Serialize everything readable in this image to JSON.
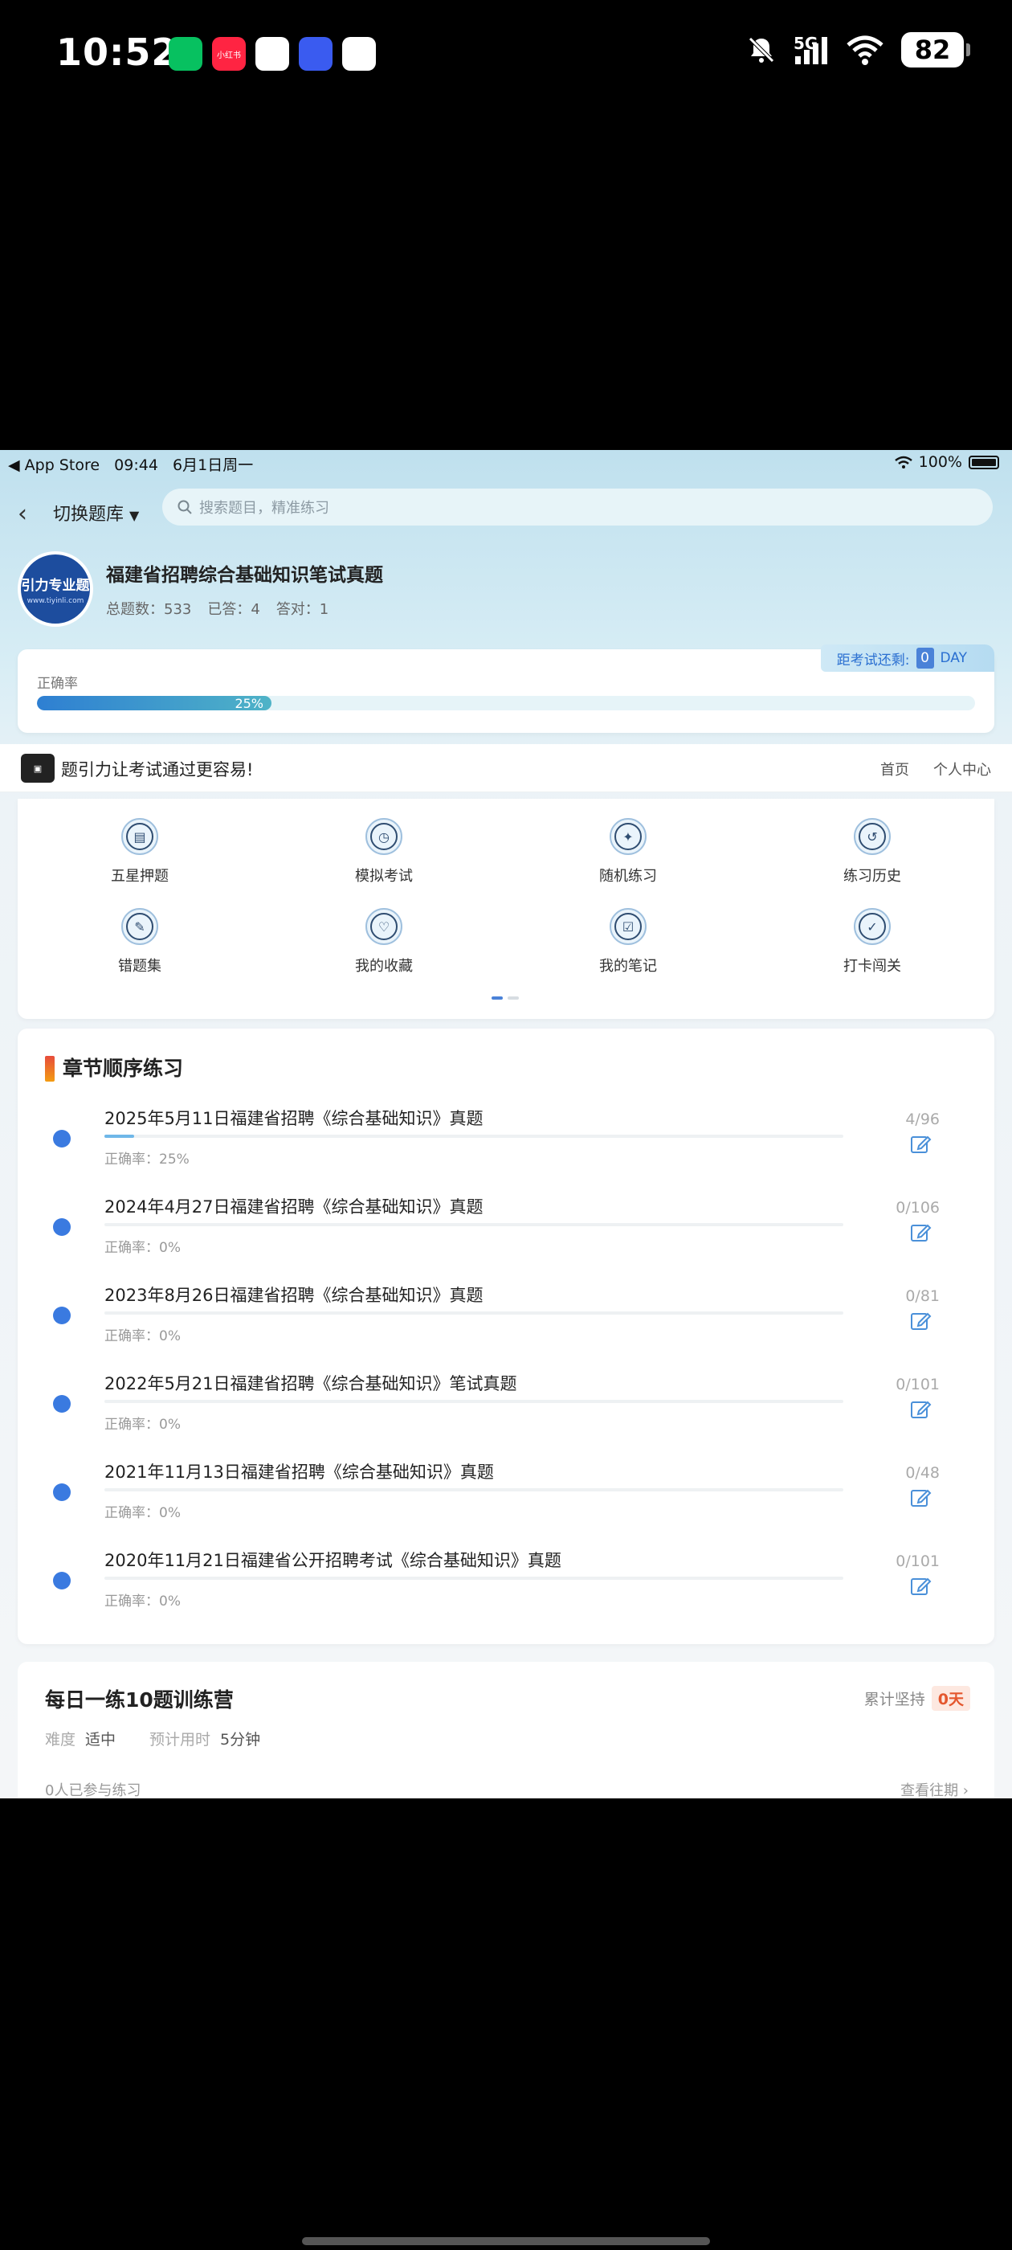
{
  "os_status": {
    "time": "10:52",
    "network": "5G",
    "battery": "82",
    "apps": [
      {
        "name": "wechat-app-icon",
        "color": "#07c160",
        "label": ""
      },
      {
        "name": "xiaohongshu-app-icon",
        "color": "#ff2442",
        "label": "小红书"
      },
      {
        "name": "app-icon-3",
        "color": "#ffffff",
        "label": ""
      },
      {
        "name": "app-icon-4",
        "color": "#3a5bf0",
        "label": ""
      },
      {
        "name": "app-icon-5",
        "color": "#ffffff",
        "label": ""
      }
    ]
  },
  "ios_bar": {
    "back_app": "◀ App Store",
    "time": "09:44",
    "date": "6月1日周一",
    "battery": "100%"
  },
  "nav": {
    "switch_label": "切换题库",
    "search_placeholder": "搜索题目，精准练习"
  },
  "bank": {
    "logo_big": "引力专业题",
    "logo_small": "www.tiyinli.com",
    "title": "福建省招聘综合基础知识笔试真题",
    "total": "总题数：533",
    "answered": "已答：4",
    "correct": "答对：1"
  },
  "accuracy": {
    "label": "正确率",
    "percent": "25%",
    "fraction": 0.25,
    "countdown_label": "距考试还剩:",
    "countdown_value": "0",
    "countdown_unit": "DAY"
  },
  "slogan": {
    "text": "题引力让考试通过更容易!",
    "link_home": "首页",
    "link_user": "个人中心"
  },
  "menu": [
    {
      "label": "五星押题",
      "icon": "star-exam-icon",
      "glyph": "▤"
    },
    {
      "label": "模拟考试",
      "icon": "mock-exam-icon",
      "glyph": "◷"
    },
    {
      "label": "随机练习",
      "icon": "random-practice-icon",
      "glyph": "✦"
    },
    {
      "label": "练习历史",
      "icon": "history-icon",
      "glyph": "↺"
    },
    {
      "label": "错题集",
      "icon": "wrong-questions-icon",
      "glyph": "✎"
    },
    {
      "label": "我的收藏",
      "icon": "favorite-icon",
      "glyph": "♡"
    },
    {
      "label": "我的笔记",
      "icon": "notes-icon",
      "glyph": "☑"
    },
    {
      "label": "打卡闯关",
      "icon": "checkin-icon",
      "glyph": "✓"
    }
  ],
  "chapter": {
    "title": "章节顺序练习",
    "items": [
      {
        "title": "2025年5月11日福建省招聘《综合基础知识》真题",
        "accuracy": "正确率：25%",
        "count": "4/96",
        "progress": 0.04
      },
      {
        "title": "2024年4月27日福建省招聘《综合基础知识》真题",
        "accuracy": "正确率：0%",
        "count": "0/106",
        "progress": 0
      },
      {
        "title": "2023年8月26日福建省招聘《综合基础知识》真题",
        "accuracy": "正确率：0%",
        "count": "0/81",
        "progress": 0
      },
      {
        "title": "2022年5月21日福建省招聘《综合基础知识》笔试真题",
        "accuracy": "正确率：0%",
        "count": "0/101",
        "progress": 0
      },
      {
        "title": "2021年11月13日福建省招聘《综合基础知识》真题",
        "accuracy": "正确率：0%",
        "count": "0/48",
        "progress": 0
      },
      {
        "title": "2020年11月21日福建省公开招聘考试《综合基础知识》真题",
        "accuracy": "正确率：0%",
        "count": "0/101",
        "progress": 0
      }
    ]
  },
  "daily": {
    "title": "每日一练10题训练营",
    "streak_label": "累计坚持",
    "streak_value": "0天",
    "difficulty_key": "难度",
    "difficulty_value": "适中",
    "time_key": "预计用时",
    "time_value": "5分钟",
    "participants": "0人已参与练习",
    "history_link": "查看往期 ›"
  }
}
